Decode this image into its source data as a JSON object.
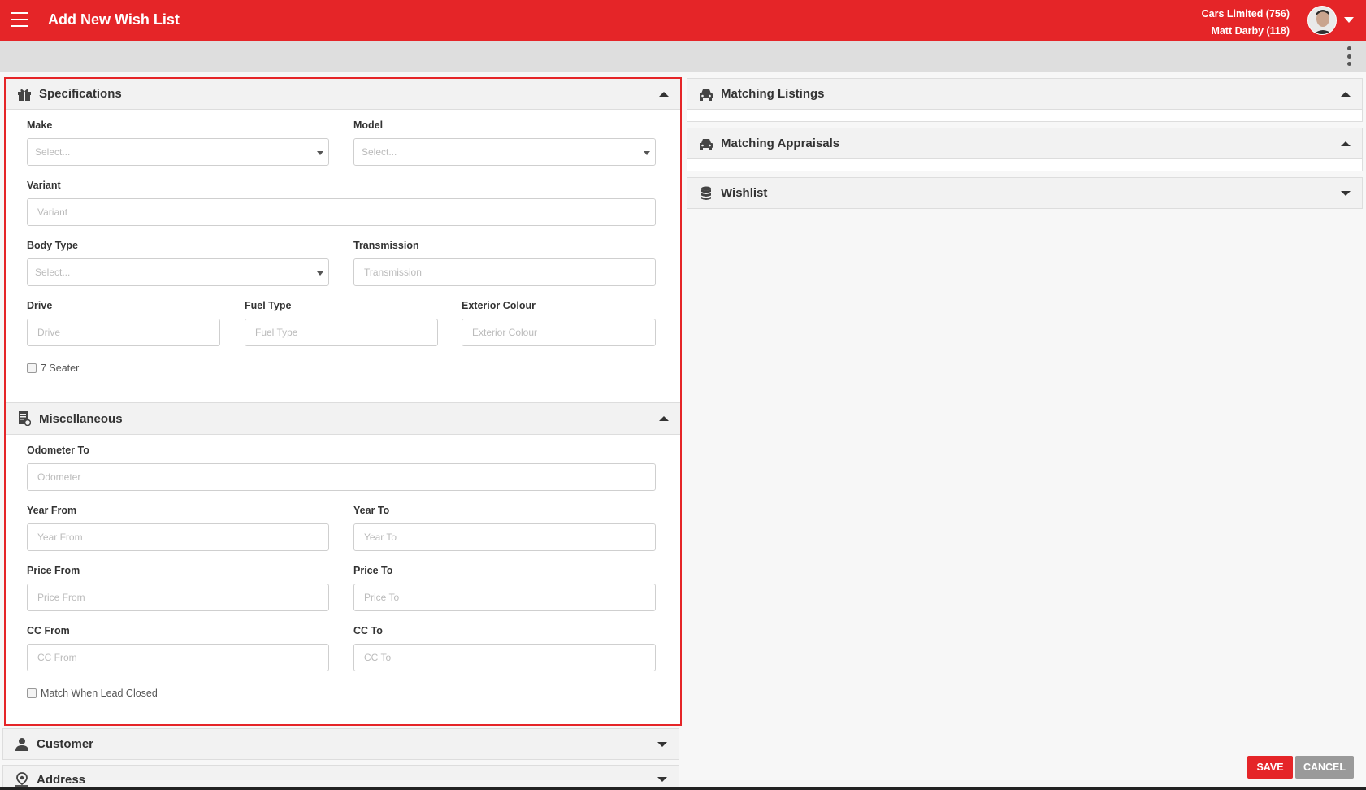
{
  "header": {
    "title": "Add New Wish List",
    "company": "Cars Limited (756)",
    "user": "Matt Darby (118)"
  },
  "colors": {
    "accent": "#e52528",
    "cancel": "#9a9a9a"
  },
  "icons": {
    "menu": "hamburger-icon",
    "more": "kebab-menu-icon",
    "specifications": "gift-icon",
    "miscellaneous": "document-icon",
    "customer": "user-icon",
    "address": "map-pin-icon",
    "listings": "car-icon",
    "wishlist": "database-icon"
  },
  "specifications": {
    "title": "Specifications",
    "make": {
      "label": "Make",
      "placeholder": "Select..."
    },
    "model": {
      "label": "Model",
      "placeholder": "Select..."
    },
    "variant": {
      "label": "Variant",
      "placeholder": "Variant"
    },
    "body_type": {
      "label": "Body Type",
      "placeholder": "Select..."
    },
    "transmission": {
      "label": "Transmission",
      "placeholder": "Transmission"
    },
    "drive": {
      "label": "Drive",
      "placeholder": "Drive"
    },
    "fuel_type": {
      "label": "Fuel Type",
      "placeholder": "Fuel Type"
    },
    "exterior_colour": {
      "label": "Exterior Colour",
      "placeholder": "Exterior Colour"
    },
    "seven_seater": "7 Seater"
  },
  "miscellaneous": {
    "title": "Miscellaneous",
    "odometer_to": {
      "label": "Odometer To",
      "placeholder": "Odometer"
    },
    "year_from": {
      "label": "Year From",
      "placeholder": "Year From"
    },
    "year_to": {
      "label": "Year To",
      "placeholder": "Year To"
    },
    "price_from": {
      "label": "Price From",
      "placeholder": "Price From"
    },
    "price_to": {
      "label": "Price To",
      "placeholder": "Price To"
    },
    "cc_from": {
      "label": "CC From",
      "placeholder": "CC From"
    },
    "cc_to": {
      "label": "CC To",
      "placeholder": "CC To"
    },
    "match_when_lead_closed": "Match When Lead Closed"
  },
  "customer": {
    "title": "Customer"
  },
  "address": {
    "title": "Address"
  },
  "right": {
    "matching_listings": "Matching Listings",
    "matching_appraisals": "Matching Appraisals",
    "wishlist": "Wishlist"
  },
  "actions": {
    "save": "SAVE",
    "cancel": "CANCEL"
  }
}
